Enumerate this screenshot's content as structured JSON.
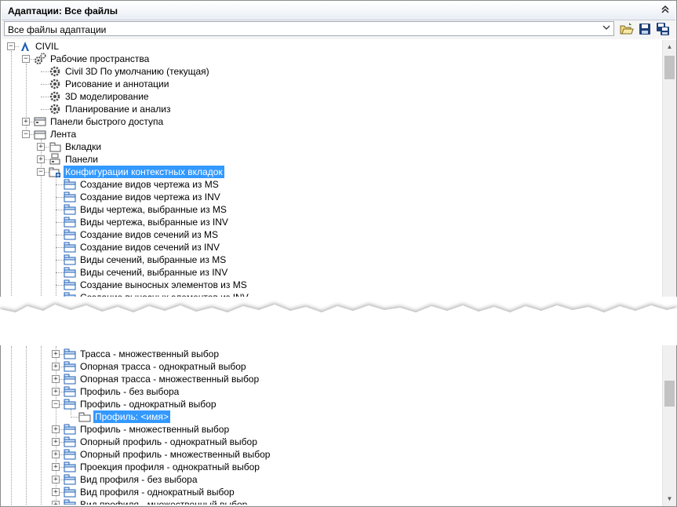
{
  "panel": {
    "title": "Адаптации: Все файлы",
    "collapse_icon": "double-chevron-up-icon"
  },
  "toolbar": {
    "select_value": "Все файлы адаптации",
    "buttons": [
      "open-folder-icon",
      "save-icon",
      "save-as-icon"
    ]
  },
  "tree_top": [
    {
      "label": "CIVIL",
      "indent": 0,
      "expander": "minus",
      "icon": "civil-a-icon"
    },
    {
      "label": "Рабочие пространства",
      "indent": 1,
      "expander": "minus",
      "icon": "workspaces-gears-icon"
    },
    {
      "label": "Civil 3D По умолчанию (текущая)",
      "indent": 2,
      "expander": "none",
      "icon": "gear-icon"
    },
    {
      "label": "Рисование и аннотации",
      "indent": 2,
      "expander": "none",
      "icon": "gear-icon"
    },
    {
      "label": "3D моделирование",
      "indent": 2,
      "expander": "none",
      "icon": "gear-icon"
    },
    {
      "label": "Планирование и анализ",
      "indent": 2,
      "expander": "none",
      "icon": "gear-icon"
    },
    {
      "label": "Панели быстрого доступа",
      "indent": 1,
      "expander": "plus",
      "icon": "quick-access-icon"
    },
    {
      "label": "Лента",
      "indent": 1,
      "expander": "minus",
      "icon": "ribbon-icon"
    },
    {
      "label": "Вкладки",
      "indent": 2,
      "expander": "plus",
      "icon": "tabs-icon"
    },
    {
      "label": "Панели",
      "indent": 2,
      "expander": "plus",
      "icon": "panels-icon"
    },
    {
      "label": "Конфигурации контекстных вкладок",
      "indent": 2,
      "expander": "minus",
      "icon": "contextual-tab-states-icon",
      "selected": true
    },
    {
      "label": "Создание видов чертежа из MS",
      "indent": 3,
      "expander": "none",
      "icon": "contextual-tab-icon"
    },
    {
      "label": "Создание видов чертежа из INV",
      "indent": 3,
      "expander": "none",
      "icon": "contextual-tab-icon"
    },
    {
      "label": "Виды чертежа, выбранные из MS",
      "indent": 3,
      "expander": "none",
      "icon": "contextual-tab-icon"
    },
    {
      "label": "Виды чертежа, выбранные из INV",
      "indent": 3,
      "expander": "none",
      "icon": "contextual-tab-icon"
    },
    {
      "label": "Создание видов сечений из MS",
      "indent": 3,
      "expander": "none",
      "icon": "contextual-tab-icon"
    },
    {
      "label": "Создание видов сечений из INV",
      "indent": 3,
      "expander": "none",
      "icon": "contextual-tab-icon"
    },
    {
      "label": "Виды сечений, выбранные из MS",
      "indent": 3,
      "expander": "none",
      "icon": "contextual-tab-icon"
    },
    {
      "label": "Виды сечений, выбранные из INV",
      "indent": 3,
      "expander": "none",
      "icon": "contextual-tab-icon"
    },
    {
      "label": "Создание выносных элементов из MS",
      "indent": 3,
      "expander": "none",
      "icon": "contextual-tab-icon"
    },
    {
      "label": "Создание выносных элементов из INV",
      "indent": 3,
      "expander": "none",
      "icon": "contextual-tab-icon"
    }
  ],
  "tree_bottom": [
    {
      "label": "Трасса - множественный выбор",
      "indent": 3,
      "expander": "plus",
      "icon": "contextual-tab-icon"
    },
    {
      "label": "Опорная трасса - однократный выбор",
      "indent": 3,
      "expander": "plus",
      "icon": "contextual-tab-icon"
    },
    {
      "label": "Опорная трасса - множественный выбор",
      "indent": 3,
      "expander": "plus",
      "icon": "contextual-tab-icon"
    },
    {
      "label": "Профиль - без выбора",
      "indent": 3,
      "expander": "plus",
      "icon": "contextual-tab-icon"
    },
    {
      "label": "Профиль - однократный выбор",
      "indent": 3,
      "expander": "minus",
      "icon": "contextual-tab-icon"
    },
    {
      "label": "Профиль: <имя>",
      "indent": 4,
      "expander": "none",
      "icon": "ribbon-tab-icon",
      "selected": true
    },
    {
      "label": "Профиль - множественный выбор",
      "indent": 3,
      "expander": "plus",
      "icon": "contextual-tab-icon"
    },
    {
      "label": "Опорный профиль - однократный выбор",
      "indent": 3,
      "expander": "plus",
      "icon": "contextual-tab-icon"
    },
    {
      "label": "Опорный профиль - множественный выбор",
      "indent": 3,
      "expander": "plus",
      "icon": "contextual-tab-icon"
    },
    {
      "label": "Проекция профиля - однократный выбор",
      "indent": 3,
      "expander": "plus",
      "icon": "contextual-tab-icon"
    },
    {
      "label": "Вид профиля - без выбора",
      "indent": 3,
      "expander": "plus",
      "icon": "contextual-tab-icon"
    },
    {
      "label": "Вид профиля - однократный выбор",
      "indent": 3,
      "expander": "plus",
      "icon": "contextual-tab-icon"
    },
    {
      "label": "Вид профиля - множественный выбор",
      "indent": 3,
      "expander": "plus",
      "icon": "contextual-tab-icon"
    }
  ],
  "scrollbar": {
    "up_icon": "scroll-up-arrow-icon",
    "down_icon": "scroll-down-arrow-icon"
  },
  "colors": {
    "selection": "#3399ff",
    "icon_blue": "#1f5fb4",
    "gear_gray": "#4a4a4a"
  }
}
